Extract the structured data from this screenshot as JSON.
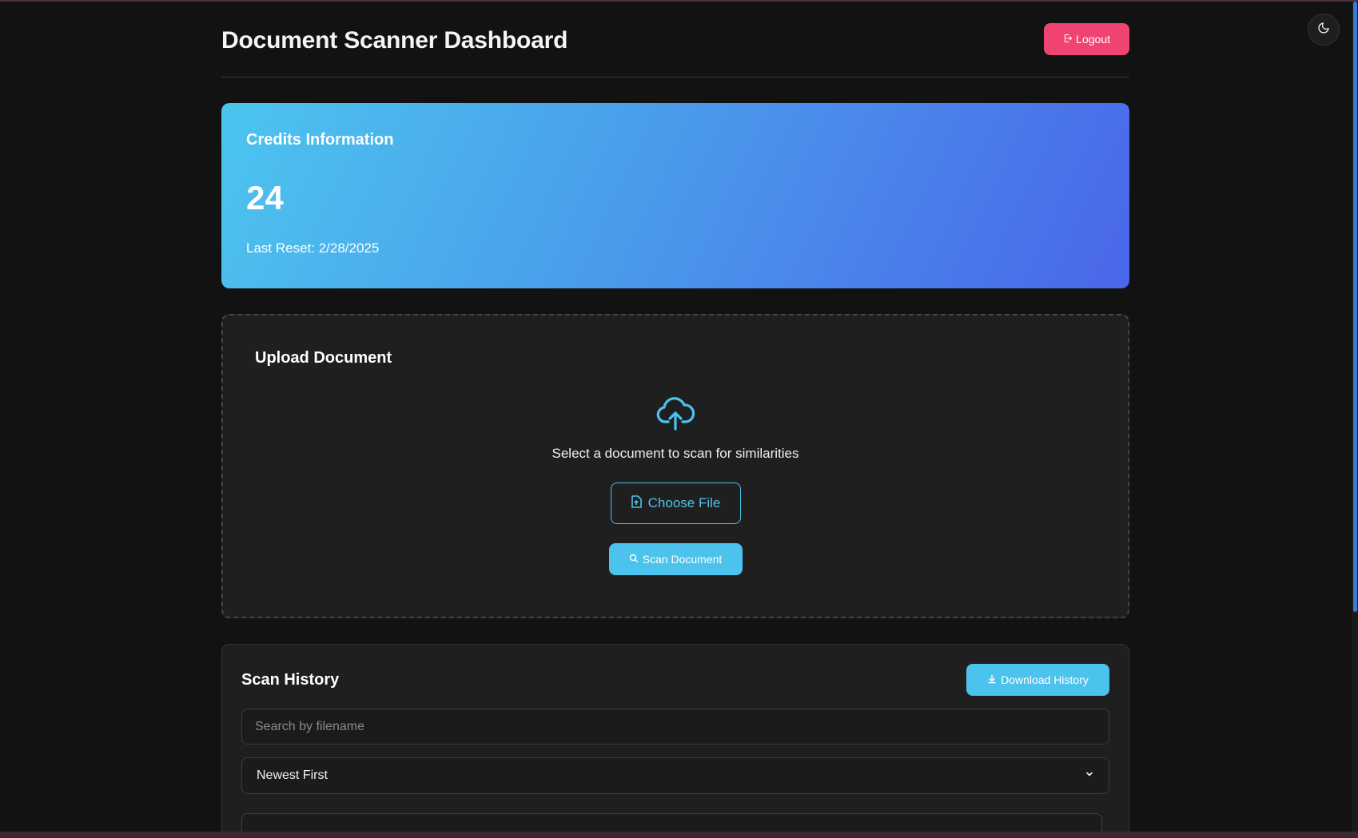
{
  "header": {
    "title": "Document Scanner Dashboard",
    "logout_label": "Logout"
  },
  "credits": {
    "title": "Credits Information",
    "value": "24",
    "last_reset": "Last Reset: 2/28/2025"
  },
  "upload": {
    "title": "Upload Document",
    "instruction": "Select a document to scan for similarities",
    "choose_file_label": "Choose File",
    "scan_label": "Scan Document"
  },
  "history": {
    "title": "Scan History",
    "download_label": "Download History",
    "search_placeholder": "Search by filename",
    "sort_selected": "Newest First"
  },
  "icons": {
    "theme": "moon-icon",
    "logout": "logout-icon",
    "upload": "cloud-upload-icon",
    "file": "file-icon",
    "search": "search-icon",
    "download": "download-icon",
    "dropdown": "chevron-down-icon"
  },
  "colors": {
    "accent": "#4cc3ec",
    "logout": "#ef4472",
    "credits_gradient_start": "#4cc5ee",
    "credits_gradient_end": "#4a66ea",
    "background": "#121212",
    "card": "#1f1f1f"
  }
}
